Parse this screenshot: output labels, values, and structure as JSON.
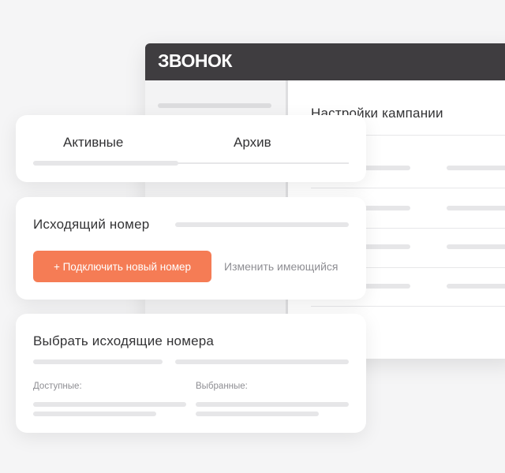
{
  "app": {
    "logo": "ЗВОНОК",
    "main_title": "Настройки кампании"
  },
  "tabs": [
    {
      "label": "Активные"
    },
    {
      "label": "Архив"
    }
  ],
  "outgoing_number": {
    "title": "Исходящий номер",
    "connect_label": "+ Подключить новый номер",
    "change_label": "Изменить имеющийся"
  },
  "select_numbers": {
    "title": "Выбрать исходящие номера",
    "available_label": "Доступные:",
    "selected_label": "Выбранные:"
  },
  "colors": {
    "accent": "#f57c55",
    "header_bg": "#3f3d40",
    "page_bg": "#f5f5f6"
  }
}
